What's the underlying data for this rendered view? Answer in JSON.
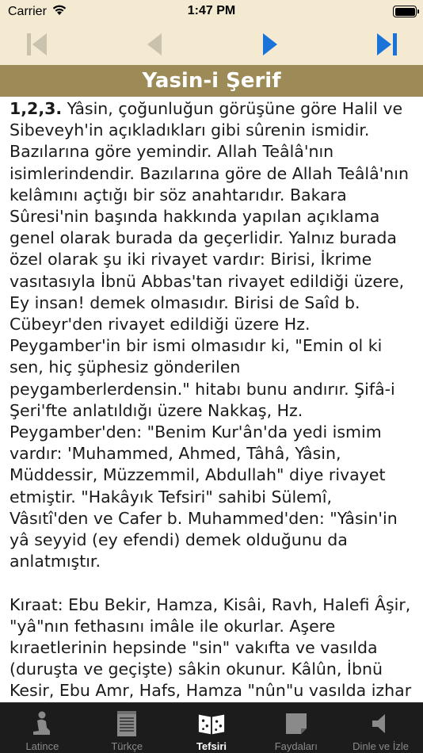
{
  "status_bar": {
    "carrier": "Carrier",
    "time": "1:47 PM"
  },
  "nav": {
    "icons": [
      "skip-to-first-icon",
      "previous-icon",
      "next-icon",
      "skip-to-last-icon"
    ],
    "disabled_color": "#c9c2ad",
    "active_color": "#1a73d9"
  },
  "title": "Yasin-i Şerif",
  "content": {
    "verse_number": "1,2,3.",
    "paragraph1": " Yâsin, çoğunluğun görüşüne göre Halil ve Sibeveyh'in açıkladıkları gibi sûrenin ismidir. Bazılarına göre yemindir. Allah Teâlâ'nın isimlerindendir. Bazılarına göre de Allah Teâlâ'nın kelâmını açtığı bir söz anahtarıdır. Bakara Sûresi'nin başında hakkında yapılan açıklama genel olarak burada da geçerlidir. Yalnız burada özel olarak şu iki rivayet vardır: Birisi, İkrime vasıtasıyla İbnü Abbas'tan rivayet edildiği üzere, Ey insan! demek olmasıdır. Birisi de Saîd b. Cübeyr'den rivayet edildiği üzere Hz. Peygamber'in bir ismi olmasıdır ki, \"Emin ol ki sen, hiç şüphesiz gönderilen peygamberlerdensin.\" hitabı bunu andırır. Şifâ-i Şeri'fte anlatıldığı üzere Nakkaş, Hz. Peygamber'den: \"Benim Kur'ân'da yedi ismim vardır: 'Muhammed, Ahmed, Tâhâ, Yâsin, Müddessir, Müzzemmil, Abdullah\" diye rivayet etmiştir. \"Hakâyık Tefsiri\" sahibi Sülemî, Vâsıtî'den ve Cafer b. Muhammed'den: \"Yâsin'in yâ seyyid (ey efendi) demek olduğunu da anlatmıştır.",
    "paragraph2": "Kıraat: Ebu Bekir, Hamza, Kisâi, Ravh, Halefi Âşir, \"yâ\"nın fethasını imâle ile okurlar. Aşere kıraetlerinin hepsinde \"sin\" vakıfta ve vasılda (duruşta ve geçişte) sâkin okunur. Kâlûn, İbnü Kesir, Ebu Amr, Hafs, Hamza \"nûn\"u vasılda izhar ederler."
  },
  "tabs": [
    {
      "label": "Latince",
      "icon": "praying-person-icon",
      "active": false
    },
    {
      "label": "Türkçe",
      "icon": "notepad-icon",
      "active": false
    },
    {
      "label": "Tefsiri",
      "icon": "open-book-icon",
      "active": true
    },
    {
      "label": "Faydaları",
      "icon": "note-icon",
      "active": false
    },
    {
      "label": "Dinle ve İzle",
      "icon": "speaker-icon",
      "active": false
    }
  ],
  "colors": {
    "toolbar_bg": "#f3ead1",
    "title_bg": "#9d8b57",
    "tabbar_bg": "#1c1c1c"
  }
}
